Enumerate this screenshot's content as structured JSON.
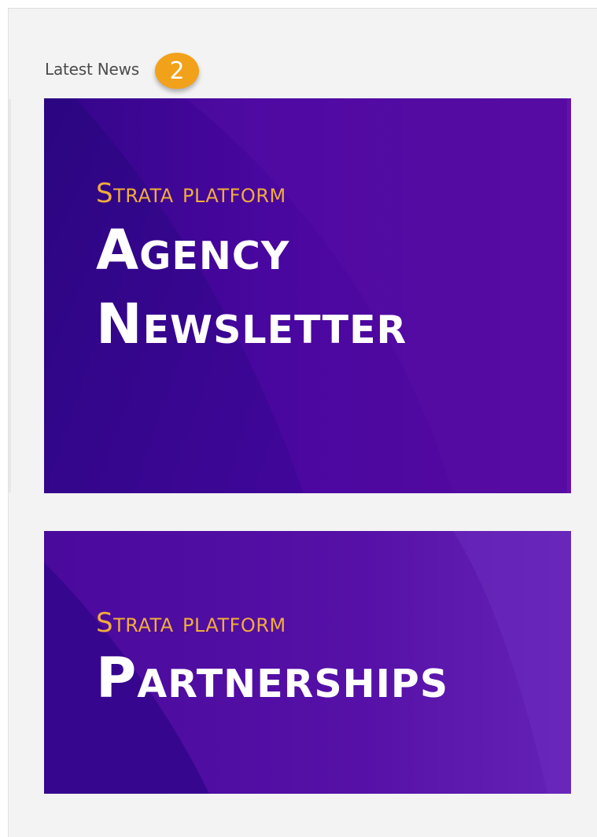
{
  "section": {
    "title": "Latest News",
    "count": "2"
  },
  "colors": {
    "background": "#f3f3f3",
    "badge": "#f2a11a",
    "card_purple": "#4f0aa0",
    "kicker_gold": "#f0ad3b"
  },
  "news": [
    {
      "kicker": "Strata platform",
      "headline_line1": "Agency",
      "headline_line2": "Newsletter"
    },
    {
      "kicker": "Strata platform",
      "headline_line1": "Partnerships"
    }
  ]
}
